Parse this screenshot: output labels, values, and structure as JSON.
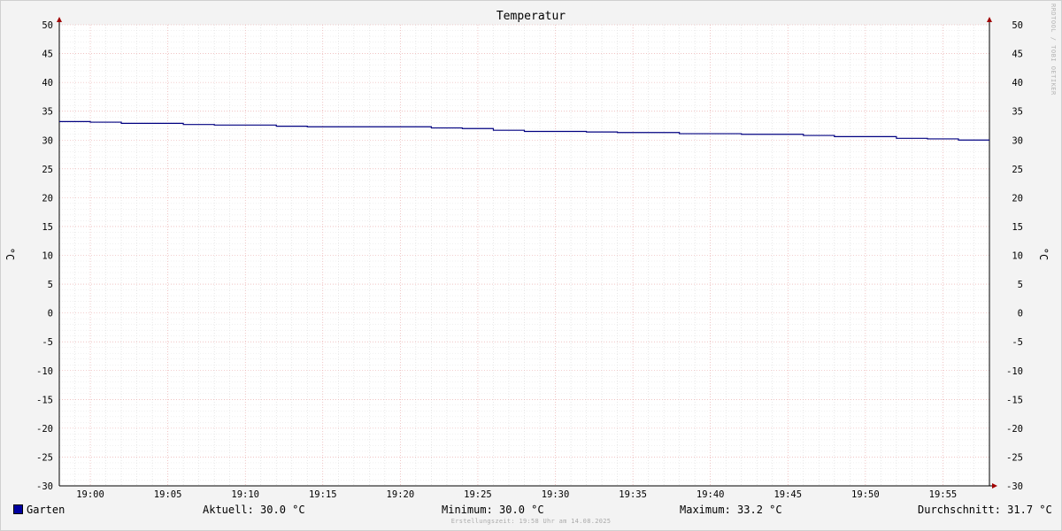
{
  "chart_data": {
    "type": "line",
    "title": "Temperatur",
    "ylabel": "°C",
    "ylim": [
      -30,
      50
    ],
    "y_ticks": [
      -30,
      -25,
      -20,
      -15,
      -10,
      -5,
      0,
      5,
      10,
      15,
      20,
      25,
      30,
      35,
      40,
      45,
      50
    ],
    "x_tick_labels": [
      "19:00",
      "19:05",
      "19:10",
      "19:15",
      "19:20",
      "19:25",
      "19:30",
      "19:35",
      "19:40",
      "19:45",
      "19:50",
      "19:55"
    ],
    "x_range_minutes": [
      -2,
      58
    ],
    "grid": true,
    "series": [
      {
        "name": "Garten",
        "color": "#000080",
        "points": [
          [
            -2,
            33.2
          ],
          [
            0,
            33.1
          ],
          [
            2,
            32.9
          ],
          [
            4,
            32.9
          ],
          [
            6,
            32.7
          ],
          [
            8,
            32.6
          ],
          [
            10,
            32.6
          ],
          [
            12,
            32.4
          ],
          [
            14,
            32.3
          ],
          [
            16,
            32.3
          ],
          [
            18,
            32.3
          ],
          [
            20,
            32.3
          ],
          [
            22,
            32.1
          ],
          [
            24,
            32.0
          ],
          [
            26,
            31.7
          ],
          [
            28,
            31.5
          ],
          [
            30,
            31.5
          ],
          [
            32,
            31.4
          ],
          [
            34,
            31.3
          ],
          [
            36,
            31.3
          ],
          [
            38,
            31.1
          ],
          [
            40,
            31.1
          ],
          [
            42,
            31.0
          ],
          [
            44,
            31.0
          ],
          [
            46,
            30.8
          ],
          [
            48,
            30.6
          ],
          [
            50,
            30.6
          ],
          [
            52,
            30.3
          ],
          [
            54,
            30.2
          ],
          [
            56,
            30.0
          ],
          [
            58,
            30.0
          ]
        ]
      }
    ]
  },
  "watermark": "RRDTOOL / TOBI OETIKER",
  "legend": {
    "series_name": "Garten",
    "series_color": "#0000a0",
    "current": "Aktuell: 30.0 °C",
    "minimum": "Minimum: 30.0 °C",
    "maximum": "Maximum: 33.2 °C",
    "average": "Durchschnitt: 31.7 °C"
  },
  "footer": "Erstellungszeit: 19:58 Uhr am 14.08.2025"
}
